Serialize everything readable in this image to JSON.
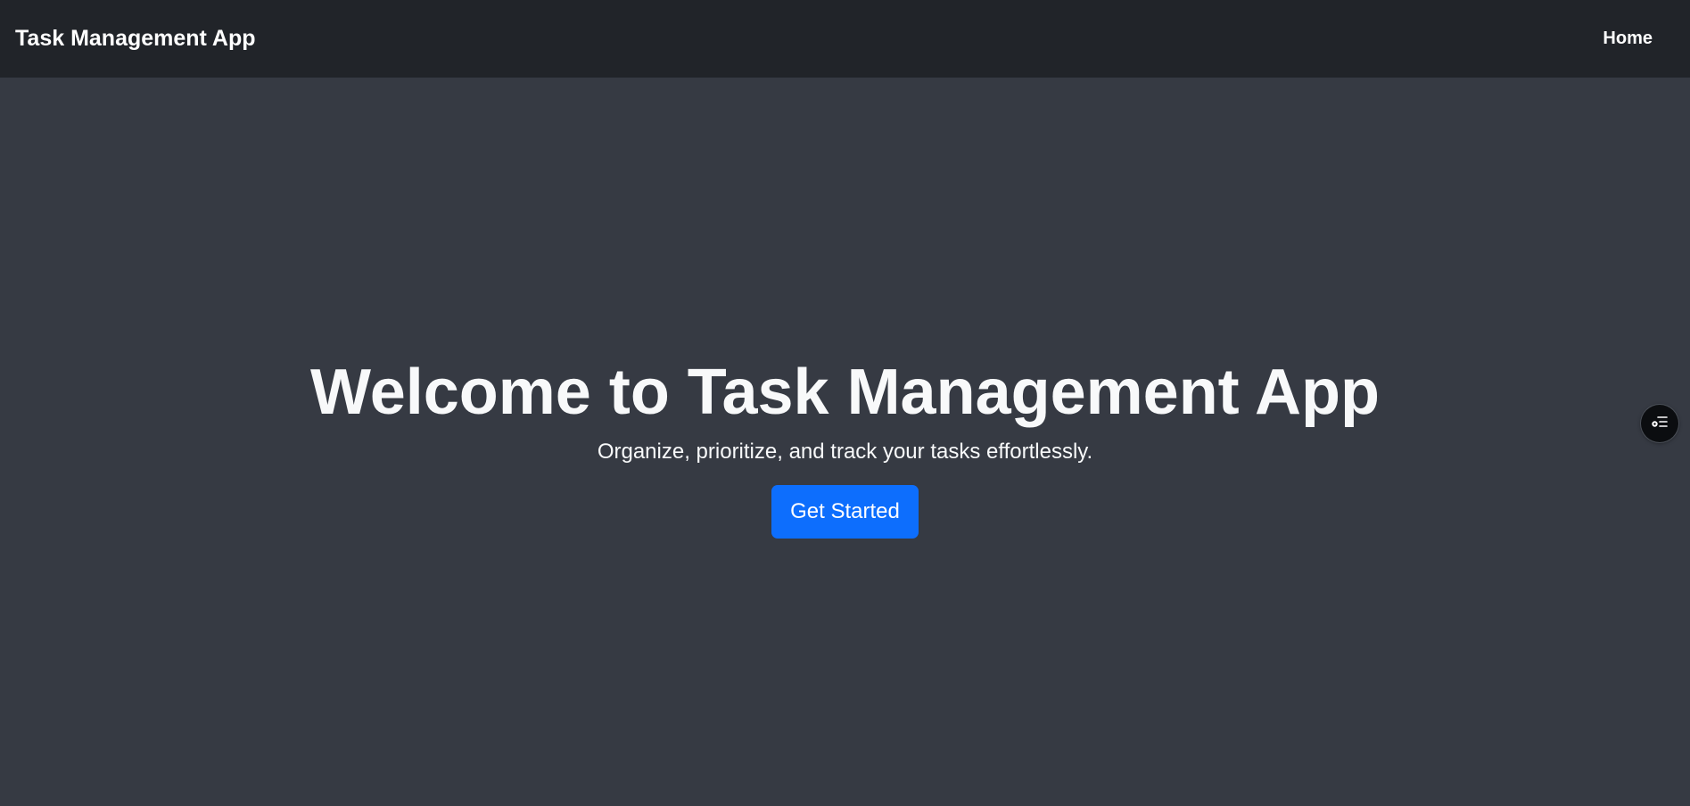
{
  "navbar": {
    "brand": "Task Management App",
    "links": [
      {
        "label": "Home"
      }
    ]
  },
  "hero": {
    "title": "Welcome to Task Management App",
    "subtitle": "Organize, prioritize, and track your tasks effortlessly.",
    "cta_label": "Get Started"
  },
  "floating_button": {
    "icon": "task-list-icon"
  },
  "colors": {
    "page_background": "#363a43",
    "navbar_background": "#212429",
    "text": "#f8f9fa",
    "primary_button": "#0d6efd",
    "floating_button_background": "#0b0d10"
  }
}
